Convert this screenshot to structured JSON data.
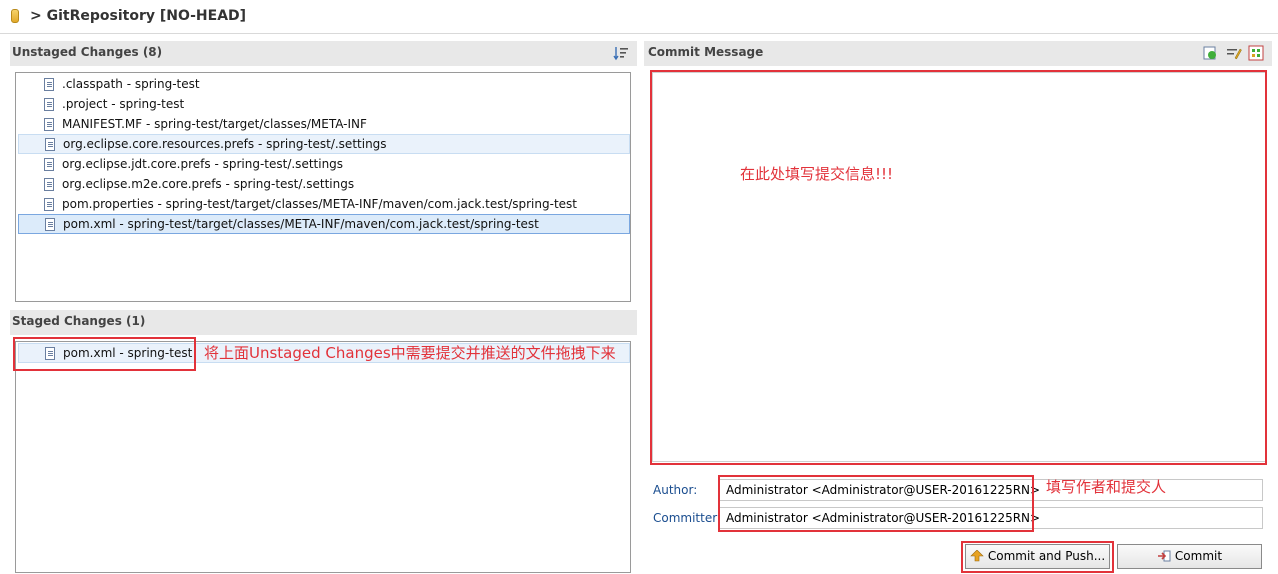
{
  "window": {
    "title": "> GitRepository [NO-HEAD]"
  },
  "unstaged": {
    "title": "Unstaged Changes",
    "count": "(8)",
    "files": [
      {
        "label": ".classpath - spring-test"
      },
      {
        "label": ".project - spring-test"
      },
      {
        "label": "MANIFEST.MF - spring-test/target/classes/META-INF"
      },
      {
        "label": "org.eclipse.core.resources.prefs - spring-test/.settings"
      },
      {
        "label": "org.eclipse.jdt.core.prefs - spring-test/.settings"
      },
      {
        "label": "org.eclipse.m2e.core.prefs - spring-test/.settings"
      },
      {
        "label": "pom.properties - spring-test/target/classes/META-INF/maven/com.jack.test/spring-test"
      },
      {
        "label": "pom.xml - spring-test/target/classes/META-INF/maven/com.jack.test/spring-test"
      }
    ]
  },
  "staged": {
    "title": "Staged Changes",
    "count": "(1)",
    "files": [
      {
        "label": "pom.xml - spring-test"
      }
    ],
    "annotation": "将上面Unstaged Changes中需要提交并推送的文件拖拽下来"
  },
  "commit": {
    "title": "Commit Message",
    "annotation": "在此处填写提交信息!!!",
    "author_label": "Author:",
    "author_value": "Administrator <Administrator@USER-20161225RN>",
    "committer_label": "Committer:",
    "committer_value": "Administrator <Administrator@USER-20161225RN>",
    "person_annotation": "填写作者和提交人",
    "commit_push_button": "Commit and Push...",
    "commit_button": "Commit"
  },
  "colors": {
    "annotation_red": "#e2323a",
    "header_gray": "#e8e8e8",
    "label_blue": "#1a4d8f"
  }
}
